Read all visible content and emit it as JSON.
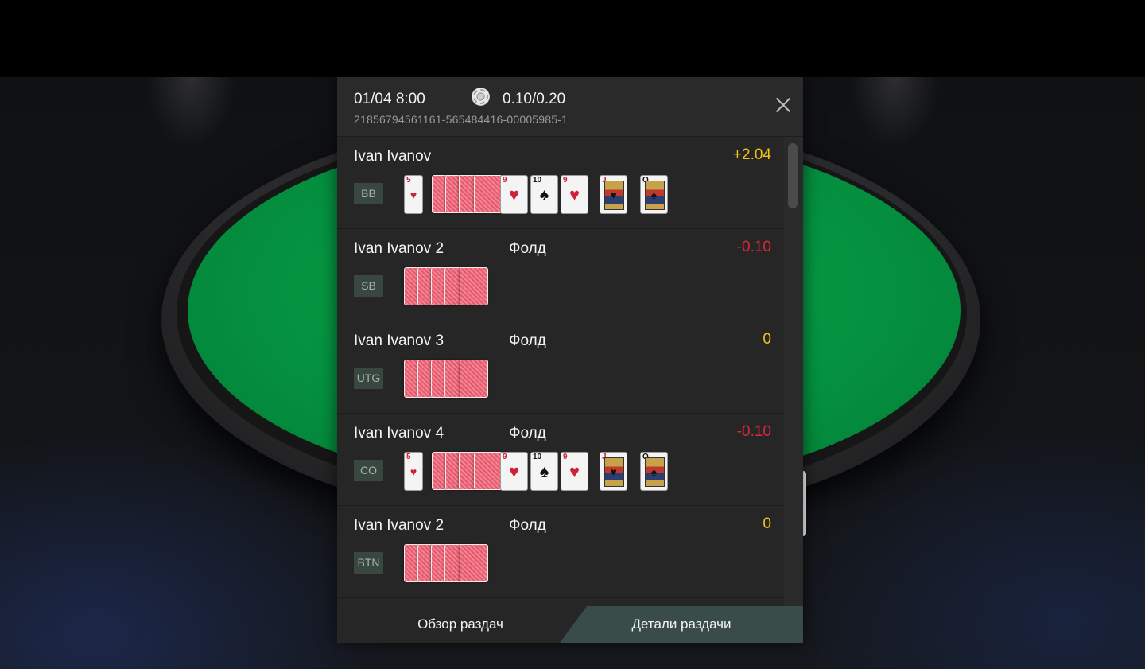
{
  "header": {
    "date": "01/04 8:00",
    "chip_icon": "poker-chip-icon",
    "stakes": "0.10/0.20",
    "hand_id": "21856794561161-565484416-00005985-1",
    "close_icon": "close-icon"
  },
  "rows": [
    {
      "name": "Ivan Ivanov",
      "action": "",
      "amount": "+2.04",
      "position": "BB",
      "revealed": true,
      "hole_card": {
        "rank": "5",
        "suit": "♥"
      },
      "board": [
        {
          "rank": "9",
          "suit": "♥"
        },
        {
          "rank": "10",
          "suit": "♠"
        },
        {
          "rank": "9",
          "suit": "♥"
        },
        {
          "rank": "J",
          "suit": "♥"
        },
        {
          "rank": "Q",
          "suit": "♠"
        }
      ]
    },
    {
      "name": "Ivan Ivanov 2",
      "action": "Фолд",
      "amount": "-0.10",
      "position": "SB",
      "revealed": false
    },
    {
      "name": "Ivan Ivanov 3",
      "action": "Фолд",
      "amount": "0",
      "position": "UTG",
      "revealed": false
    },
    {
      "name": "Ivan Ivanov 4",
      "action": "Фолд",
      "amount": "-0.10",
      "position": "CO",
      "revealed": true,
      "hole_card": {
        "rank": "5",
        "suit": "♥"
      },
      "board": [
        {
          "rank": "9",
          "suit": "♥"
        },
        {
          "rank": "10",
          "suit": "♠"
        },
        {
          "rank": "9",
          "suit": "♥"
        },
        {
          "rank": "J",
          "suit": "♥"
        },
        {
          "rank": "Q",
          "suit": "♠"
        }
      ]
    },
    {
      "name": "Ivan Ivanov 2",
      "action": "Фолд",
      "amount": "0",
      "position": "BTN",
      "revealed": false
    }
  ],
  "tabs": {
    "overview": "Обзор раздач",
    "details": "Детали раздачи",
    "active": "details"
  },
  "colors": {
    "positive": "#f0c419",
    "negative": "#d9283a",
    "felt": "#049240",
    "active_tab": "#3a4c4a"
  }
}
